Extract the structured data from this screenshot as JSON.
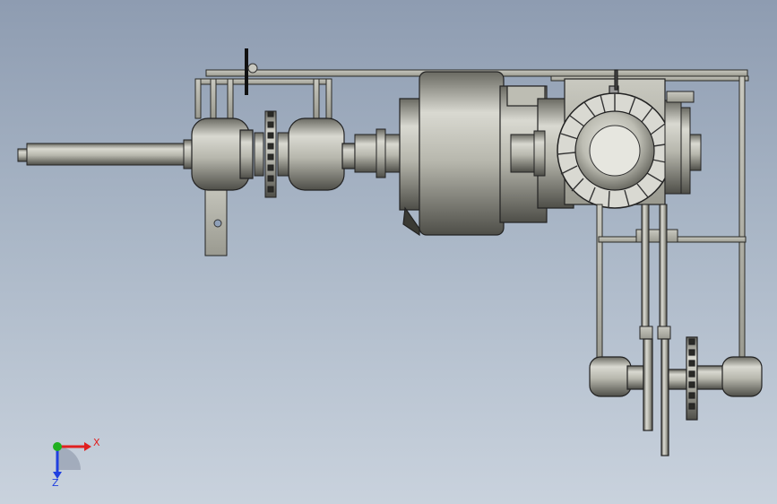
{
  "app": {
    "view": "cad-3d-viewport"
  },
  "colors": {
    "background_top": "#8e9cb1",
    "background_bottom": "#c9d2dd",
    "metal_light": "#d7d7cf",
    "metal_mid": "#a9a99f",
    "metal_dark": "#55554e",
    "outline": "#1f1f1f",
    "axis_x": "#e02020",
    "axis_y": "#20b020",
    "axis_z": "#2040e0"
  },
  "triad": {
    "x_label": "X",
    "z_label": "Z",
    "icon": "coordinate-triad-icon"
  }
}
